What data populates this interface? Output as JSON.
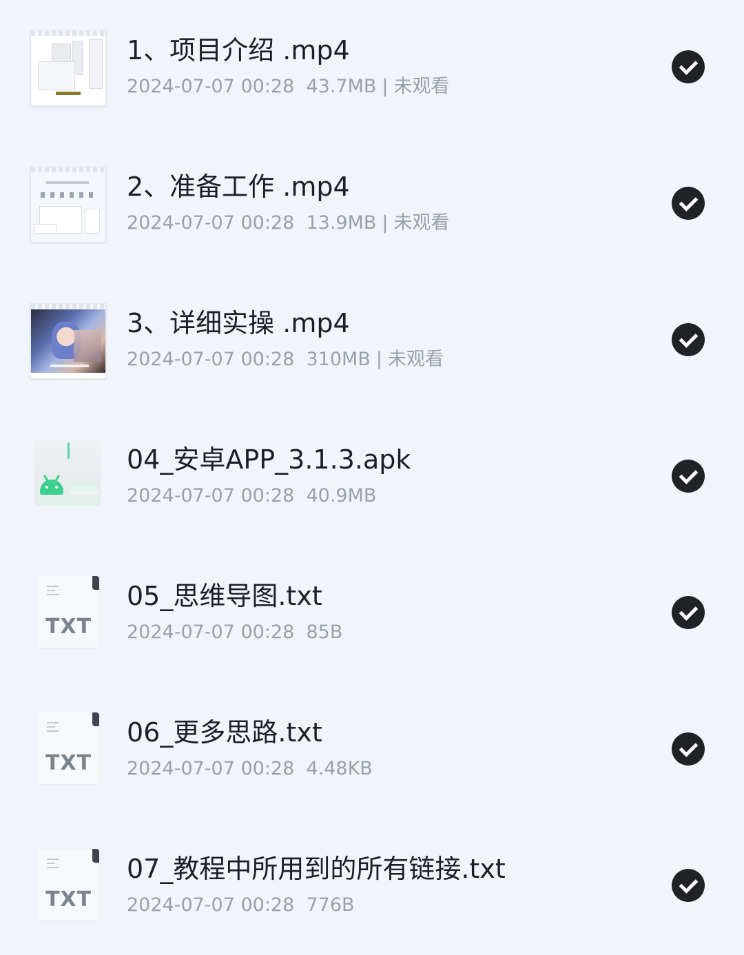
{
  "files": [
    {
      "name": "1、项目介绍 .mp4",
      "date": "2024-07-07 00:28",
      "size": "43.7MB",
      "sep": "|",
      "status": "未观看",
      "icon": "video-thumbnail"
    },
    {
      "name": "2、准备工作 .mp4",
      "date": "2024-07-07 00:28",
      "size": "13.9MB",
      "sep": "|",
      "status": "未观看",
      "icon": "video-thumbnail"
    },
    {
      "name": "3、详细实操 .mp4",
      "date": "2024-07-07 00:28",
      "size": "310MB",
      "sep": "|",
      "status": "未观看",
      "icon": "video-thumbnail"
    },
    {
      "name": "04_安卓APP_3.1.3.apk",
      "date": "2024-07-07 00:28",
      "size": "40.9MB",
      "icon": "android-apk-icon"
    },
    {
      "name": "05_思维导图.txt",
      "date": "2024-07-07 00:28",
      "size": "85B",
      "icon": "txt-file-icon",
      "icon_label": "TXT"
    },
    {
      "name": "06_更多思路.txt",
      "date": "2024-07-07 00:28",
      "size": "4.48KB",
      "icon": "txt-file-icon",
      "icon_label": "TXT"
    },
    {
      "name": "07_教程中所用到的所有链接.txt",
      "date": "2024-07-07 00:28",
      "size": "776B",
      "icon": "txt-file-icon",
      "icon_label": "TXT"
    }
  ],
  "colors": {
    "background": "#f1f4fa",
    "check": "#202226",
    "meta": "#9aa0aa",
    "title": "#1d1f24"
  }
}
